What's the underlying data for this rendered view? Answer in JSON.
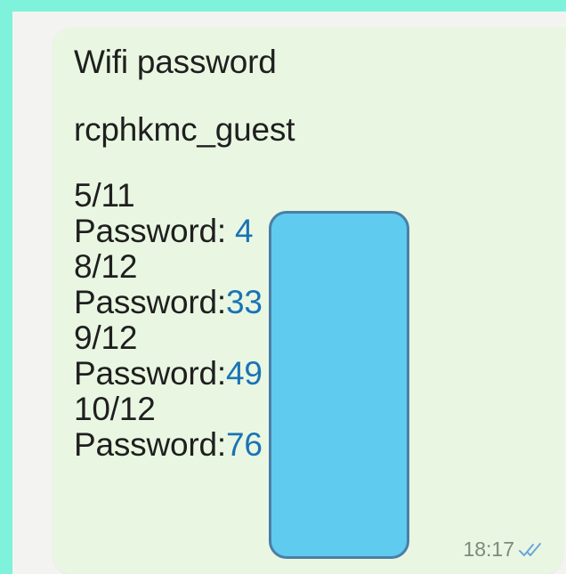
{
  "message": {
    "title": "Wifi password",
    "network": "rcphkmc_guest",
    "entries": [
      {
        "date": "5/11",
        "label": "Password: ",
        "value": "4"
      },
      {
        "date": "8/12",
        "label": "Password:",
        "value": "33"
      },
      {
        "date": "9/12",
        "label": "Password:",
        "value": "49"
      },
      {
        "date": "10/12",
        "label": "Password:",
        "value": "76"
      }
    ],
    "time": "18:17",
    "status_icon": "double-check-icon"
  },
  "colors": {
    "frame": "#7ef2da",
    "bubble": "#e9f7e2",
    "link": "#1a73b5",
    "redaction": "#5ecbef",
    "redaction_border": "#4b7ea6"
  }
}
